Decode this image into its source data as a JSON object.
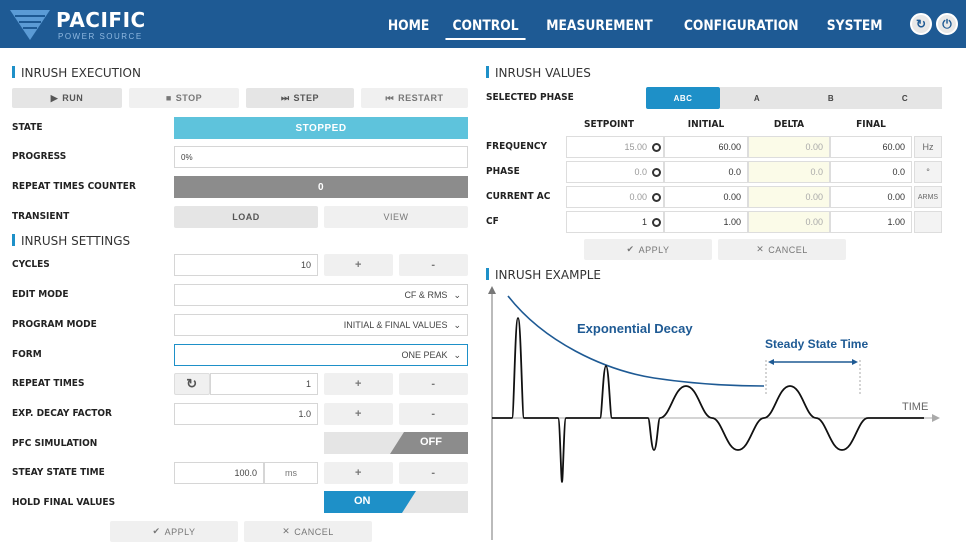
{
  "logo": {
    "name": "PACIFIC",
    "tagline": "POWER SOURCE"
  },
  "nav": [
    "HOME",
    "CONTROL",
    "MEASUREMENT",
    "CONFIGURATION",
    "SYSTEM"
  ],
  "topbar_icons": [
    "refresh-icon",
    "power-icon"
  ],
  "execution": {
    "title": "INRUSH EXECUTION",
    "buttons": {
      "run": "RUN",
      "stop": "STOP",
      "step": "STEP",
      "restart": "RESTART"
    },
    "state_label": "STATE",
    "state_value": "STOPPED",
    "progress_label": "PROGRESS",
    "progress_value": "0%",
    "repeat_counter_label": "REPEAT TIMES COUNTER",
    "repeat_counter_value": "0",
    "transient_label": "TRANSIENT",
    "load": "LOAD",
    "view": "VIEW"
  },
  "settings": {
    "title": "INRUSH SETTINGS",
    "cycles_label": "CYCLES",
    "cycles_value": "10",
    "edit_mode_label": "EDIT MODE",
    "edit_mode_value": "CF & RMS",
    "program_mode_label": "PROGRAM MODE",
    "program_mode_value": "INITIAL & FINAL VALUES",
    "form_label": "FORM",
    "form_value": "ONE PEAK",
    "repeat_times_label": "REPEAT TIMES",
    "repeat_times_value": "1",
    "decay_label": "EXP. DECAY FACTOR",
    "decay_value": "1.0",
    "pfc_label": "PFC SIMULATION",
    "pfc_value": "OFF",
    "steady_label": "STEAY STATE TIME",
    "steady_value": "100.0",
    "steady_unit": "ms",
    "hold_label": "HOLD FINAL VALUES",
    "hold_value": "ON",
    "plus": "+",
    "minus": "-",
    "apply": "APPLY",
    "cancel": "CANCEL"
  },
  "values": {
    "title": "INRUSH VALUES",
    "phase_label": "SELECTED PHASE",
    "phases": [
      "ABC",
      "A",
      "B",
      "C"
    ],
    "columns": [
      "SETPOINT",
      "INITIAL",
      "DELTA",
      "FINAL"
    ],
    "rows": [
      {
        "label": "FREQUENCY",
        "setpoint": "15.00",
        "initial": "60.00",
        "delta": "0.00",
        "final": "60.00",
        "unit": "Hz"
      },
      {
        "label": "PHASE",
        "setpoint": "0.0",
        "initial": "0.0",
        "delta": "0.0",
        "final": "0.0",
        "unit": "°"
      },
      {
        "label": "CURRENT AC",
        "setpoint": "0.00",
        "initial": "0.00",
        "delta": "0.00",
        "final": "0.00",
        "unit": "ARMS"
      },
      {
        "label": "CF",
        "setpoint": "1",
        "initial": "1.00",
        "delta": "0.00",
        "final": "1.00",
        "unit": ""
      }
    ],
    "apply": "APPLY",
    "cancel": "CANCEL"
  },
  "example": {
    "title": "INRUSH EXAMPLE",
    "decay_label": "Exponential Decay",
    "steady_label": "Steady State Time",
    "time_label": "TIME"
  },
  "colors": {
    "topbar": "#1e5a94",
    "accent": "#1e90c8",
    "state_bar": "#5ec3dc",
    "counter_bar": "#8c8c8c",
    "toggle_dark": "#8c8c8c"
  }
}
